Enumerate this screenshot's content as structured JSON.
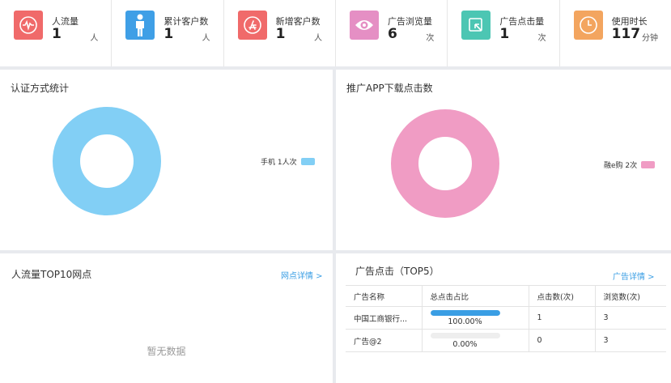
{
  "stats": [
    {
      "label": "人流量",
      "value": "1",
      "unit": "人",
      "color": "#f06a6a",
      "icon": "pulse-icon"
    },
    {
      "label": "累计客户数",
      "value": "1",
      "unit": "人",
      "color": "#3f9fe6",
      "icon": "person-icon"
    },
    {
      "label": "新增客户数",
      "value": "1",
      "unit": "人",
      "color": "#f06a6a",
      "icon": "app-store-icon"
    },
    {
      "label": "广告浏览量",
      "value": "6",
      "unit": "次",
      "color": "#e58fc4",
      "icon": "eye-icon"
    },
    {
      "label": "广告点击量",
      "value": "1",
      "unit": "次",
      "color": "#4cc6b3",
      "icon": "click-icon"
    },
    {
      "label": "使用时长",
      "value": "117",
      "unit": "分钟",
      "color": "#f3a55f",
      "icon": "clock-icon"
    }
  ],
  "auth_panel": {
    "title": "认证方式统计",
    "legend_label": "手机",
    "legend_value": "1人次",
    "color": "#82cff5"
  },
  "app_panel": {
    "title": "推广APP下载点击数",
    "legend_label": "融e购",
    "legend_value": "2次",
    "color": "#f09cc4"
  },
  "traffic_panel": {
    "title": "人流量TOP10网点",
    "link": "网点详情 >",
    "empty": "暂无数据"
  },
  "ads_panel": {
    "title": "广告点击（TOP5）",
    "link": "广告详情 >",
    "columns": [
      "广告名称",
      "总点击占比",
      "点击数(次)",
      "浏览数(次)"
    ],
    "rows": [
      {
        "name": "中国工商银行...",
        "ratio": 1.0,
        "ratio_text": "100.00%",
        "clicks": "1",
        "views": "3"
      },
      {
        "name": "广告@2",
        "ratio": 0.0,
        "ratio_text": "0.00%",
        "clicks": "0",
        "views": "3"
      }
    ]
  },
  "chart_data": [
    {
      "type": "pie",
      "categories": [
        "手机"
      ],
      "values": [
        1
      ],
      "title": "认证方式统计"
    },
    {
      "type": "pie",
      "categories": [
        "融e购"
      ],
      "values": [
        2
      ],
      "title": "推广APP下载点击数"
    }
  ]
}
